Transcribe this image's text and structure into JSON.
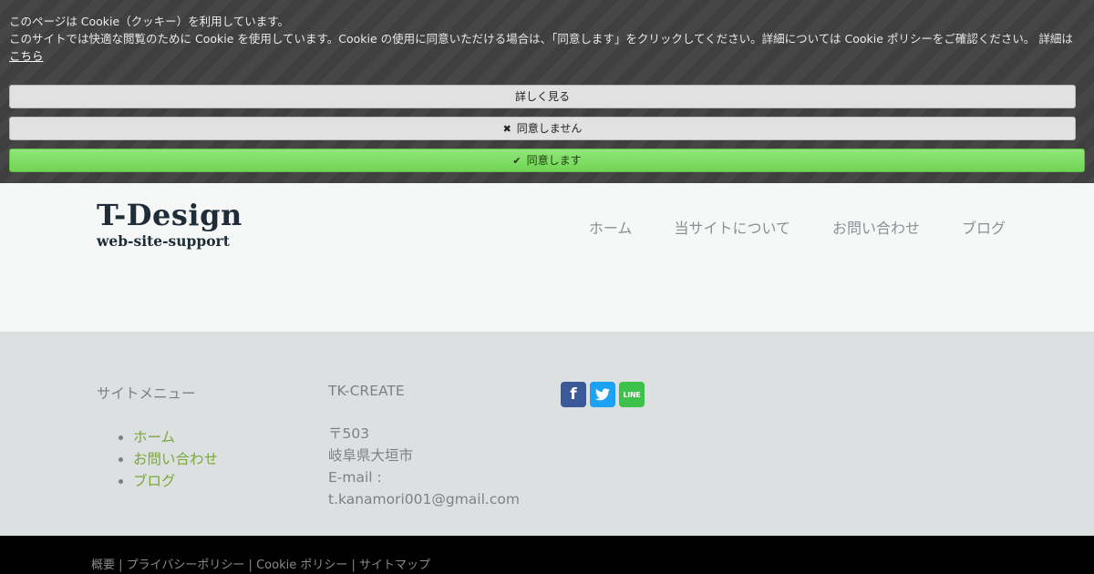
{
  "cookie": {
    "title": "このページは Cookie（クッキー）を利用しています。",
    "body": "このサイトでは快適な閲覧のために Cookie を使用しています。Cookie の使用に同意いただける場合は、「同意します」をクリックしてください。詳細については Cookie ポリシーをご確認ください。 詳細は",
    "link_label": "こちら",
    "more_label": "詳しく見る",
    "decline_label": "同意しません",
    "accept_label": "同意します",
    "decline_icon": "close-icon",
    "accept_icon": "check-icon"
  },
  "header": {
    "logo_main": "T-Design",
    "logo_sub": "web-site-support",
    "nav": [
      "ホーム",
      "当サイトについて",
      "お問い合わせ",
      "ブログ"
    ]
  },
  "footer": {
    "menu_title": "サイトメニュー",
    "menu_items": [
      "ホーム",
      "お問い合わせ",
      "ブログ"
    ],
    "company": "TK-CREATE",
    "postal": "〒503",
    "city": "岐阜県大垣市",
    "email_label": "E-mail :",
    "email": "t.kanamori001@gmail.com",
    "social": {
      "facebook_glyph": "f",
      "line_label": "LINE"
    }
  },
  "bottom": {
    "links": [
      "概要",
      "プライバシーポリシー",
      "Cookie ポリシー",
      "サイトマップ"
    ],
    "separator": " | "
  },
  "colors": {
    "accent_green": "#7aa63a",
    "accept_green": "#7edc63",
    "facebook": "#3b5998",
    "twitter": "#1da1f2",
    "line": "#3ec14a"
  }
}
